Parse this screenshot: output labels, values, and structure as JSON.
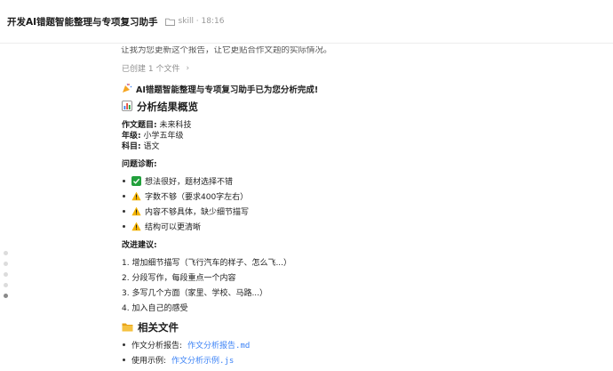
{
  "header": {
    "title": "开发AI错题智能整理与专项复习助手",
    "meta": "skill · 18:16",
    "folder_icon": "folder-icon"
  },
  "chat": {
    "cut_line": "让我为您更新这个报告，让它更贴合作文题的实际情况。",
    "created_files": "已创建 1 个文件",
    "done_msg": "AI错题智能整理与专项复习助手已为您分析完成!",
    "overview_title": "分析结果概览",
    "fields": [
      {
        "label": "作文题目:",
        "value": "未来科技"
      },
      {
        "label": "年级:",
        "value": "小学五年级"
      },
      {
        "label": "科目:",
        "value": "语文"
      }
    ],
    "diagnosis_title": "问题诊断:",
    "diagnosis": [
      {
        "icon": "check-icon",
        "text": "想法很好，题材选择不错"
      },
      {
        "icon": "warning-icon",
        "text": "字数不够（要求400字左右）"
      },
      {
        "icon": "warning-icon",
        "text": "内容不够具体，缺少细节描写"
      },
      {
        "icon": "warning-icon",
        "text": "结构可以更清晰"
      }
    ],
    "improve_title": "改进建议:",
    "improvements": [
      "1. 增加细节描写（飞行汽车的样子、怎么飞...）",
      "2. 分段写作，每段重点一个内容",
      "3. 多写几个方面（家里、学校、马路...）",
      "4. 加入自己的感受"
    ],
    "files_title": "相关文件",
    "files": [
      {
        "label": "作文分析报告:",
        "file": "作文分析报告.md"
      },
      {
        "label": "使用示例:",
        "file": "作文分析示例.js"
      }
    ]
  },
  "colors": {
    "accent": "#3b82f6",
    "check": "#22a03c",
    "warning": "#f5b400",
    "folder": "#e8a317"
  }
}
